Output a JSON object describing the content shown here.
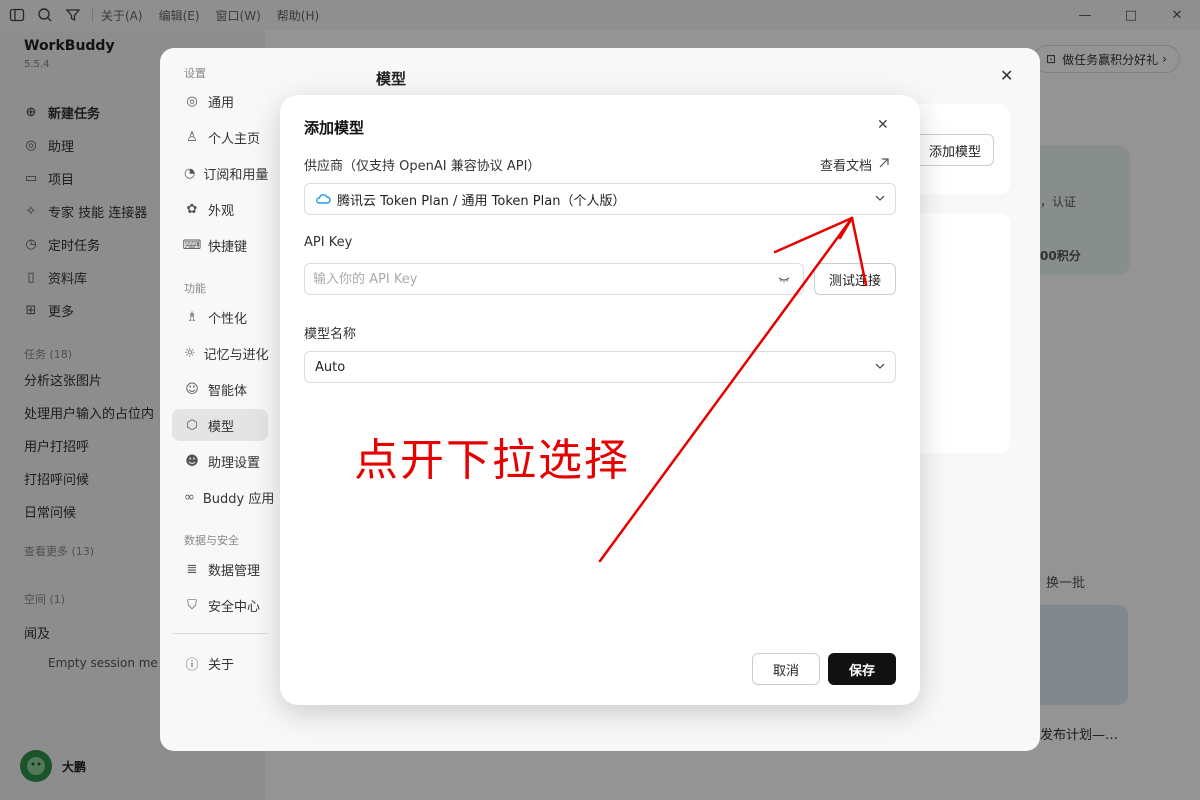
{
  "titlebar": {
    "menus": [
      "关于(A)",
      "编辑(E)",
      "窗口(W)",
      "帮助(H)"
    ]
  },
  "app": {
    "name": "WorkBuddy",
    "version": "5.5.4"
  },
  "sidebar": {
    "nav": [
      {
        "label": "新建任务",
        "icon": "plus-circle-icon"
      },
      {
        "label": "助理",
        "icon": "assistant-icon"
      },
      {
        "label": "项目",
        "icon": "folder-icon"
      },
      {
        "label": "专家 技能 连接器",
        "icon": "expert-icon"
      },
      {
        "label": "定时任务",
        "icon": "clock-icon"
      },
      {
        "label": "资料库",
        "icon": "book-icon"
      },
      {
        "label": "更多",
        "icon": "grid-icon"
      }
    ],
    "tasks_header": "任务 (18)",
    "tasks": [
      "分析这张图片",
      "处理用户输入的占位内",
      "用户打招呼",
      "打招呼问候",
      "日常问候"
    ],
    "see_more": "查看更多 (13)",
    "space_header": "空间 (1)",
    "space_name": "闻及",
    "space_empty": "Empty session me",
    "user_name": "大鹏"
  },
  "background": {
    "promo": "做任务赢积分好礼",
    "promo_text1": "，认证",
    "promo_text2": "00积分",
    "switch_batch": "换一批",
    "release_plan": "发布计划—…"
  },
  "settings": {
    "title": "模型",
    "sections": {
      "settings": "设置",
      "features": "功能",
      "data_security": "数据与安全"
    },
    "items": [
      {
        "label": "通用",
        "icon": "general-icon"
      },
      {
        "label": "个人主页",
        "icon": "user-icon"
      },
      {
        "label": "订阅和用量",
        "icon": "pie-icon"
      },
      {
        "label": "外观",
        "icon": "palette-icon"
      },
      {
        "label": "快捷键",
        "icon": "keyboard-icon"
      },
      {
        "label": "个性化",
        "icon": "person-icon"
      },
      {
        "label": "记忆与进化",
        "icon": "bulb-icon"
      },
      {
        "label": "智能体",
        "icon": "bot-icon"
      },
      {
        "label": "模型",
        "icon": "model-icon"
      },
      {
        "label": "助理设置",
        "icon": "assistant-settings-icon"
      },
      {
        "label": "Buddy 应用",
        "icon": "link-icon"
      },
      {
        "label": "数据管理",
        "icon": "database-icon"
      },
      {
        "label": "安全中心",
        "icon": "shield-icon"
      },
      {
        "label": "关于",
        "icon": "info-icon"
      }
    ],
    "add_model_button": "添加模型"
  },
  "modal": {
    "title": "添加模型",
    "provider_label": "供应商（仅支持 OpenAI 兼容协议 API）",
    "view_docs": "查看文档",
    "provider_value": "腾讯云 Token Plan / 通用 Token Plan（个人版）",
    "api_key_label": "API Key",
    "api_key_placeholder": "输入你的 API Key",
    "api_key_value": "",
    "test_button": "测试连接",
    "model_name_label": "模型名称",
    "model_name_value": "Auto",
    "cancel_button": "取消",
    "save_button": "保存"
  },
  "annotation": {
    "text": "点开下拉选择",
    "color": "#e60000"
  }
}
